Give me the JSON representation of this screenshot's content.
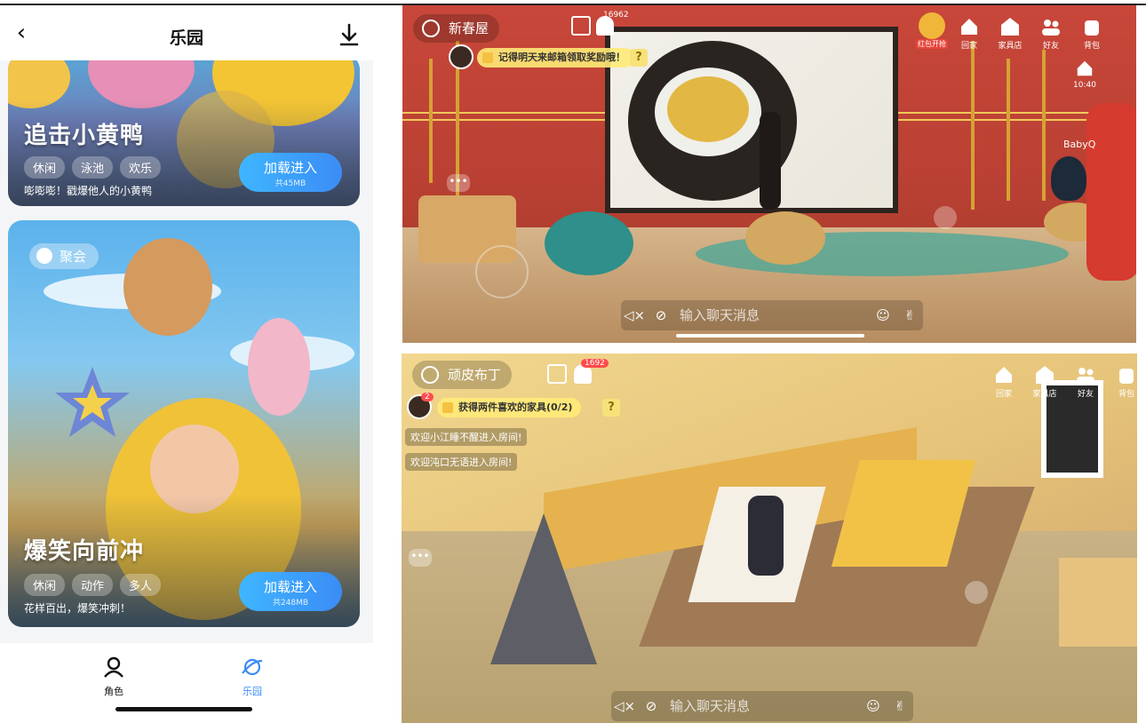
{
  "phone": {
    "header": {
      "title": "乐园",
      "back_icon": "chevron-left-icon",
      "download_icon": "download-icon"
    },
    "games": [
      {
        "name": "追击小黄鸭",
        "tags": [
          "休闲",
          "泳池",
          "欢乐"
        ],
        "desc": "嘭嘭嘭！戳爆他人的小黄鸭",
        "button": "加载进入",
        "size": "共45MB"
      },
      {
        "name": "爆笑向前冲",
        "tags": [
          "休闲",
          "动作",
          "多人"
        ],
        "desc": "花样百出，爆笑冲刺！",
        "button": "加载进入",
        "size": "共248MB",
        "badge": "聚会"
      }
    ],
    "tabbar": [
      {
        "label": "角色",
        "icon": "person-icon",
        "active": false
      },
      {
        "label": "乐园",
        "icon": "planet-icon",
        "active": true
      }
    ],
    "accent": "#3b8cf5"
  },
  "shot1": {
    "room_name": "新春屋",
    "notif_count": "16962",
    "task_text": "记得明天来邮箱领取奖励哦！",
    "task_help": "?",
    "red_event": "红包开抢",
    "menu": [
      "回家",
      "家具店",
      "好友",
      "背包"
    ],
    "side_time": "10:40",
    "npc_name": "BabyQ",
    "chat_placeholder": "输入聊天消息"
  },
  "shot2": {
    "room_name": "顽皮布丁",
    "notif_count": "1692",
    "avatar_badge": "2",
    "task_text": "获得两件喜欢的家具(0/2)",
    "task_help": "?",
    "welcome": [
      "欢迎小江睡不醒进入房间!",
      "欢迎沌口无语进入房间!"
    ],
    "menu": [
      "回家",
      "家具店",
      "好友",
      "背包"
    ],
    "chat_placeholder": "输入聊天消息"
  }
}
